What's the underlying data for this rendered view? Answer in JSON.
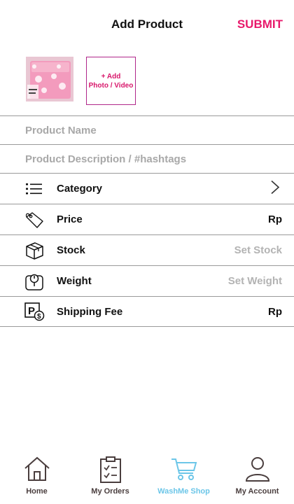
{
  "header": {
    "title": "Add Product",
    "submit_label": "SUBMIT"
  },
  "media": {
    "add_label_line1": "+ Add",
    "add_label_line2": "Photo / Video"
  },
  "fields": {
    "product_name_placeholder": "Product Name",
    "product_description_placeholder": "Product Description / #hashtags"
  },
  "rows": {
    "category": {
      "label": "Category"
    },
    "price": {
      "label": "Price",
      "value": "Rp"
    },
    "stock": {
      "label": "Stock",
      "value": "Set Stock"
    },
    "weight": {
      "label": "Weight",
      "value": "Set Weight"
    },
    "shipping": {
      "label": "Shipping Fee",
      "value": "Rp"
    }
  },
  "nav": [
    {
      "label": "Home",
      "icon": "home-icon"
    },
    {
      "label": "My Orders",
      "icon": "clipboard-icon"
    },
    {
      "label": "WashMe Shop",
      "icon": "cart-icon"
    },
    {
      "label": "My Account",
      "icon": "user-icon"
    }
  ],
  "colors": {
    "accent": "#e8196b",
    "active_nav": "#6cc6e8",
    "divider": "#9a9a9a"
  }
}
